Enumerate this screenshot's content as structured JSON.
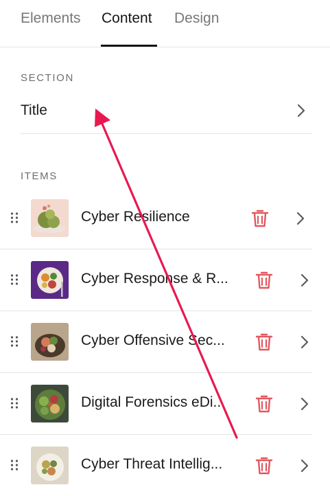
{
  "tabs": [
    {
      "label": "Elements",
      "active": false
    },
    {
      "label": "Content",
      "active": true
    },
    {
      "label": "Design",
      "active": false
    }
  ],
  "section": {
    "heading": "SECTION",
    "title_row": {
      "label": "Title",
      "icon": "chevron-right-icon"
    }
  },
  "items": {
    "heading": "ITEMS",
    "list": [
      {
        "title": "Cyber Resilience",
        "thumbnail": "food-photo-thumbnail",
        "icon_delete": "trash-icon",
        "icon_open": "chevron-right-icon"
      },
      {
        "title": "Cyber Response & R...",
        "thumbnail": "food-photo-thumbnail",
        "icon_delete": "trash-icon",
        "icon_open": "chevron-right-icon"
      },
      {
        "title": "Cyber Offensive Sec...",
        "thumbnail": "food-photo-thumbnail",
        "icon_delete": "trash-icon",
        "icon_open": "chevron-right-icon"
      },
      {
        "title": "Digital Forensics eDi...",
        "thumbnail": "food-photo-thumbnail",
        "icon_delete": "trash-icon",
        "icon_open": "chevron-right-icon"
      },
      {
        "title": "Cyber Threat Intellig...",
        "thumbnail": "food-photo-thumbnail",
        "icon_delete": "trash-icon",
        "icon_open": "chevron-right-icon"
      }
    ]
  },
  "colors": {
    "delete_icon": "#e2575f",
    "annotation_arrow": "#e8194f",
    "divider": "#e3e3e3",
    "active_tab": "#151515",
    "inactive_tab": "#777777"
  }
}
